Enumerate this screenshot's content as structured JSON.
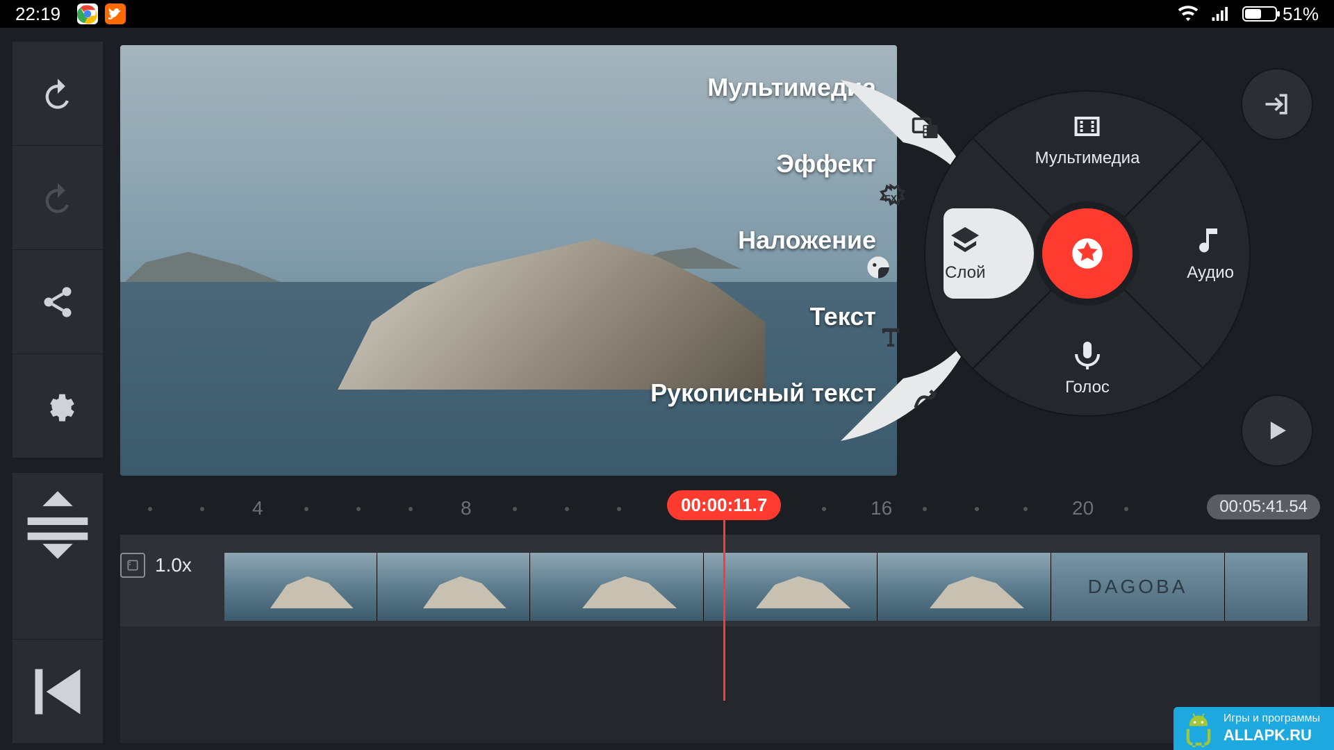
{
  "status": {
    "time": "22:19",
    "battery": "51%"
  },
  "labels": {
    "multimedia": "Мультимедиа",
    "effect": "Эффект",
    "overlay": "Наложение",
    "text": "Текст",
    "handwriting": "Рукописный текст"
  },
  "wheel": {
    "top": "Мультимедиа",
    "right": "Аудио",
    "bottom": "Голос",
    "left": "Слой"
  },
  "timeline": {
    "playhead": "00:00:11.7",
    "total": "00:05:41.54",
    "speed": "1.0x",
    "marks": [
      "4",
      "8",
      "16",
      "20"
    ],
    "clip_text": "DAGOBA"
  },
  "watermark": {
    "tagline": "Игры и программы",
    "site": "ALLAPK.RU"
  }
}
